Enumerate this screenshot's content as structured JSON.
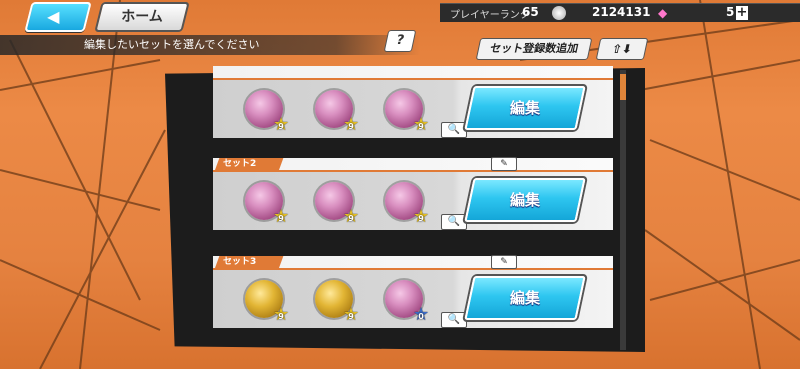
{
  "topbar": {
    "back_icon": "back-arrow-icon",
    "home_label": "ホーム",
    "rank_label": "プレイヤーランク",
    "rank_value": "65",
    "coin_icon": "coin-icon",
    "coin_value": "2124131",
    "gem_icon": "gem-icon",
    "gem_value": "5",
    "plus_label": "+"
  },
  "instructions": "編集したいセットを選んでください",
  "help_label": "?",
  "add_set_label": "セット登録数追加",
  "sort_label": "⇧⬇",
  "sets": [
    {
      "label": "",
      "edit_label": "編集",
      "medals": [
        {
          "color": "pink",
          "star": "gold",
          "level": "9"
        },
        {
          "color": "pink",
          "star": "gold",
          "level": "9"
        },
        {
          "color": "pink",
          "star": "gold",
          "level": "9"
        }
      ]
    },
    {
      "label": "セット2",
      "edit_label": "編集",
      "medals": [
        {
          "color": "pink",
          "star": "gold",
          "level": "9"
        },
        {
          "color": "pink",
          "star": "gold",
          "level": "9"
        },
        {
          "color": "pink",
          "star": "gold",
          "level": "9"
        }
      ]
    },
    {
      "label": "セット3",
      "edit_label": "編集",
      "medals": [
        {
          "color": "gold",
          "star": "gold",
          "level": "9"
        },
        {
          "color": "gold",
          "star": "gold",
          "level": "9"
        },
        {
          "color": "pink",
          "star": "blue",
          "level": "0"
        }
      ]
    }
  ],
  "colors": {
    "accent_orange": "#e07a36",
    "edit_blue": "#2ec6f0",
    "panel_dark": "#1c1c1c"
  }
}
